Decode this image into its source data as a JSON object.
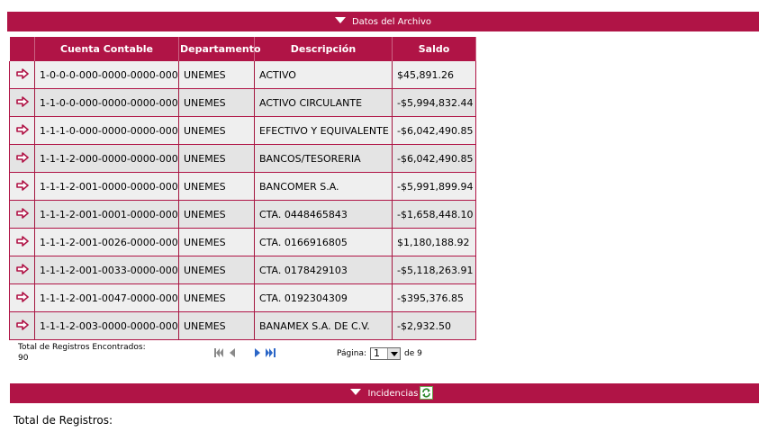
{
  "header_bar": {
    "title": "Datos del Archivo"
  },
  "table": {
    "columns": [
      "",
      "Cuenta Contable",
      "Departamento",
      "Descripción",
      "Saldo"
    ],
    "rows": [
      {
        "cuenta": "1-0-0-0-000-0000-0000-000",
        "depto": "UNEMES",
        "desc": "ACTIVO",
        "saldo": "$45,891.26"
      },
      {
        "cuenta": "1-1-0-0-000-0000-0000-000",
        "depto": "UNEMES",
        "desc": "ACTIVO CIRCULANTE",
        "saldo": "-$5,994,832.44"
      },
      {
        "cuenta": "1-1-1-0-000-0000-0000-000",
        "depto": "UNEMES",
        "desc": "EFECTIVO Y EQUIVALENTE",
        "saldo": "-$6,042,490.85"
      },
      {
        "cuenta": "1-1-1-2-000-0000-0000-000",
        "depto": "UNEMES",
        "desc": "BANCOS/TESORERIA",
        "saldo": "-$6,042,490.85"
      },
      {
        "cuenta": "1-1-1-2-001-0000-0000-000",
        "depto": "UNEMES",
        "desc": "BANCOMER S.A.",
        "saldo": "-$5,991,899.94"
      },
      {
        "cuenta": "1-1-1-2-001-0001-0000-000",
        "depto": "UNEMES",
        "desc": "CTA. 0448465843",
        "saldo": "-$1,658,448.10"
      },
      {
        "cuenta": "1-1-1-2-001-0026-0000-000",
        "depto": "UNEMES",
        "desc": "CTA. 0166916805",
        "saldo": "$1,180,188.92"
      },
      {
        "cuenta": "1-1-1-2-001-0033-0000-000",
        "depto": "UNEMES",
        "desc": "CTA. 0178429103",
        "saldo": "-$5,118,263.91"
      },
      {
        "cuenta": "1-1-1-2-001-0047-0000-000",
        "depto": "UNEMES",
        "desc": "CTA. 0192304309",
        "saldo": "-$395,376.85"
      },
      {
        "cuenta": "1-1-1-2-003-0000-0000-000",
        "depto": "UNEMES",
        "desc": "BANAMEX S.A. DE C.V.",
        "saldo": "-$2,932.50"
      }
    ]
  },
  "footer": {
    "total_label": "Total de Registros Encontrados:",
    "total_value": "90",
    "page_label": "Página:",
    "page_value": "1",
    "page_of": "de 9"
  },
  "incidencias_bar": {
    "title": "Incidencias"
  },
  "records_label": "Total de Registros:",
  "colors": {
    "accent": "#b01446"
  },
  "icons": [
    "arrow-right-icon",
    "first-page-icon",
    "prev-page-icon",
    "next-page-icon",
    "last-page-icon",
    "refresh-icon",
    "chevron-down-icon"
  ]
}
